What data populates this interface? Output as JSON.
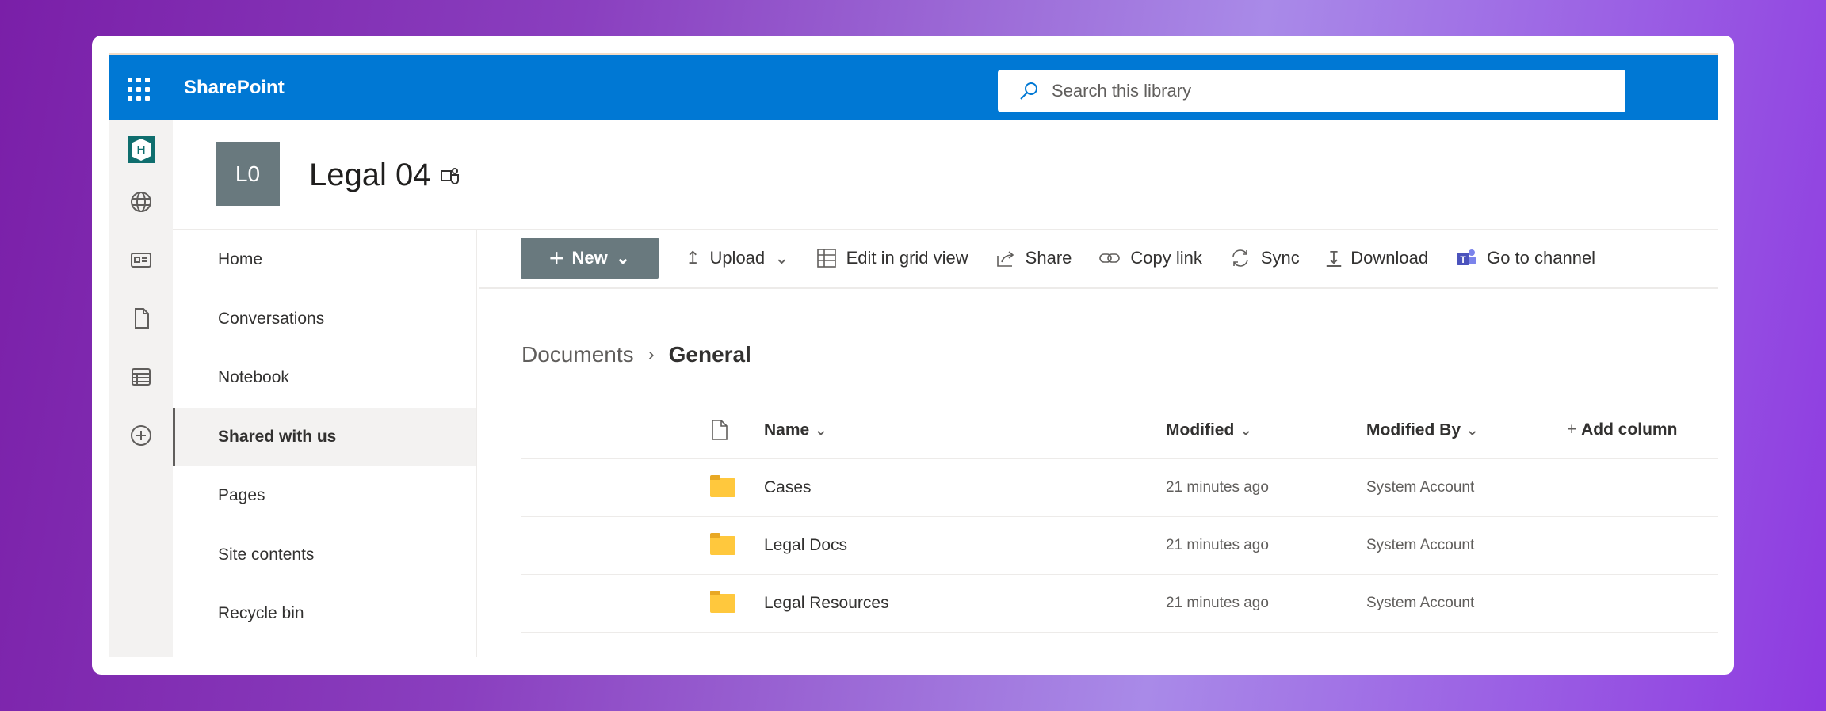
{
  "app": {
    "brand": "SharePoint",
    "search_placeholder": "Search this library"
  },
  "site": {
    "logo_initials": "L0",
    "title": "Legal 04"
  },
  "nav": [
    "Home",
    "Conversations",
    "Notebook",
    "Shared with us",
    "Pages",
    "Site contents",
    "Recycle bin"
  ],
  "nav_selected": "Shared with us",
  "commands": {
    "new": "New",
    "upload": "Upload",
    "grid": "Edit in grid view",
    "share": "Share",
    "copy": "Copy link",
    "sync": "Sync",
    "download": "Download",
    "channel": "Go to channel"
  },
  "breadcrumb": {
    "parent": "Documents",
    "current": "General"
  },
  "columns": {
    "name": "Name",
    "modified": "Modified",
    "modified_by": "Modified By",
    "add": "Add column"
  },
  "rows": [
    {
      "name": "Cases",
      "modified": "21 minutes ago",
      "by": "System Account"
    },
    {
      "name": "Legal Docs",
      "modified": "21 minutes ago",
      "by": "System Account"
    },
    {
      "name": "Legal Resources",
      "modified": "21 minutes ago",
      "by": "System Account"
    }
  ],
  "colors": {
    "brand": "#0078d4",
    "logo": "#69797e"
  }
}
